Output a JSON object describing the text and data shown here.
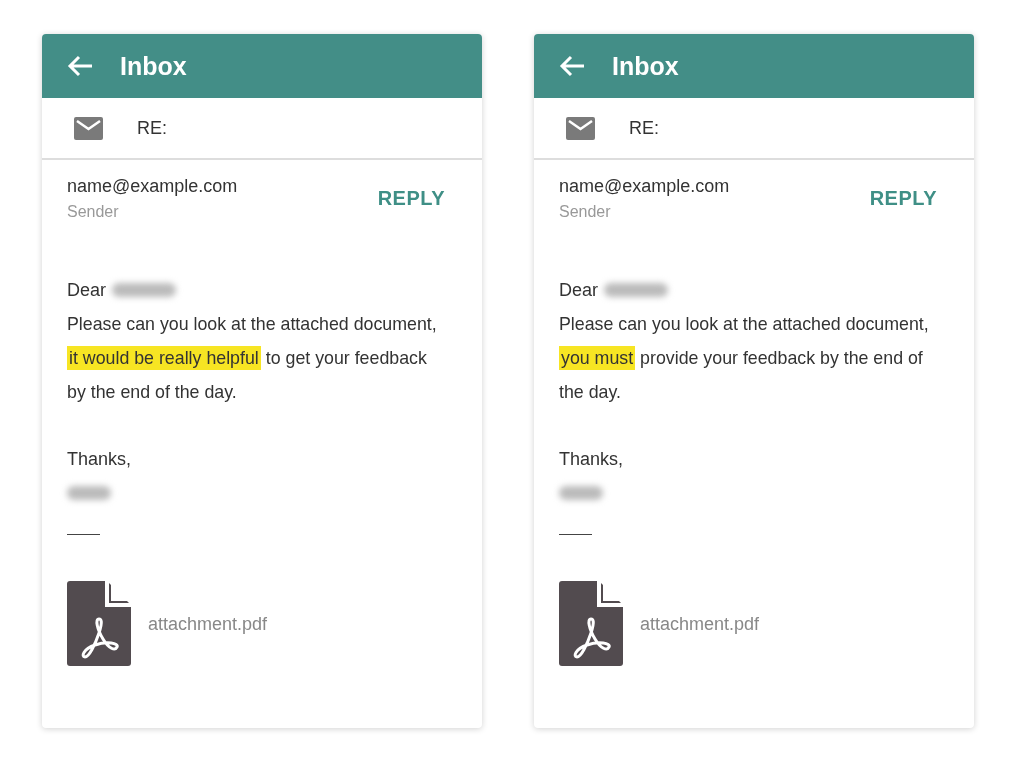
{
  "cards": [
    {
      "title": "Inbox",
      "subject": "RE:",
      "sender_email": "name@example.com",
      "sender_label": "Sender",
      "reply": "REPLY",
      "greeting": "Dear",
      "body": [
        {
          "text": "Please can you look at the attached document, ",
          "highlight": false
        },
        {
          "text": "it would be really helpful",
          "highlight": true
        },
        {
          "text": " to get your feedback by the end of the day.",
          "highlight": false
        }
      ],
      "signoff": "Thanks,",
      "attachment": "attachment.pdf"
    },
    {
      "title": "Inbox",
      "subject": "RE:",
      "sender_email": "name@example.com",
      "sender_label": "Sender",
      "reply": "REPLY",
      "greeting": "Dear",
      "body": [
        {
          "text": "Please can you look at the attached document, ",
          "highlight": false
        },
        {
          "text": "you must",
          "highlight": true
        },
        {
          "text": " provide your feedback by the end of the day.",
          "highlight": false
        }
      ],
      "signoff": "Thanks,",
      "attachment": "attachment.pdf"
    }
  ]
}
